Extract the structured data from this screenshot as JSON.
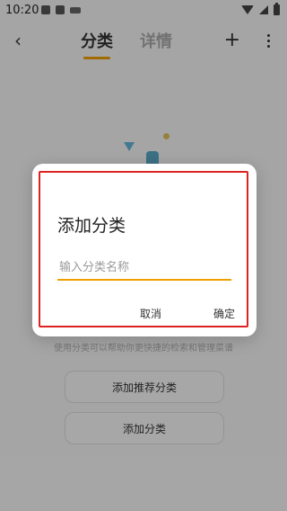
{
  "status_bar": {
    "time": "10:20"
  },
  "header": {
    "tabs": [
      "分类",
      "详情"
    ],
    "back_icon": "chevron-left-icon",
    "add_icon": "plus-icon",
    "more_icon": "more-vertical-icon"
  },
  "main": {
    "hint": "使用分类可以帮助你更快捷的检索和管理菜谱",
    "buttons": [
      "添加推荐分类",
      "添加分类"
    ]
  },
  "dialog": {
    "title": "添加分类",
    "input": {
      "value": "",
      "placeholder": "输入分类名称"
    },
    "actions": [
      "取消",
      "确定"
    ]
  },
  "colors": {
    "accent": "#f0a000",
    "highlight_border": "#dd2222",
    "scrim": "rgba(0,0,0,0.33)"
  }
}
